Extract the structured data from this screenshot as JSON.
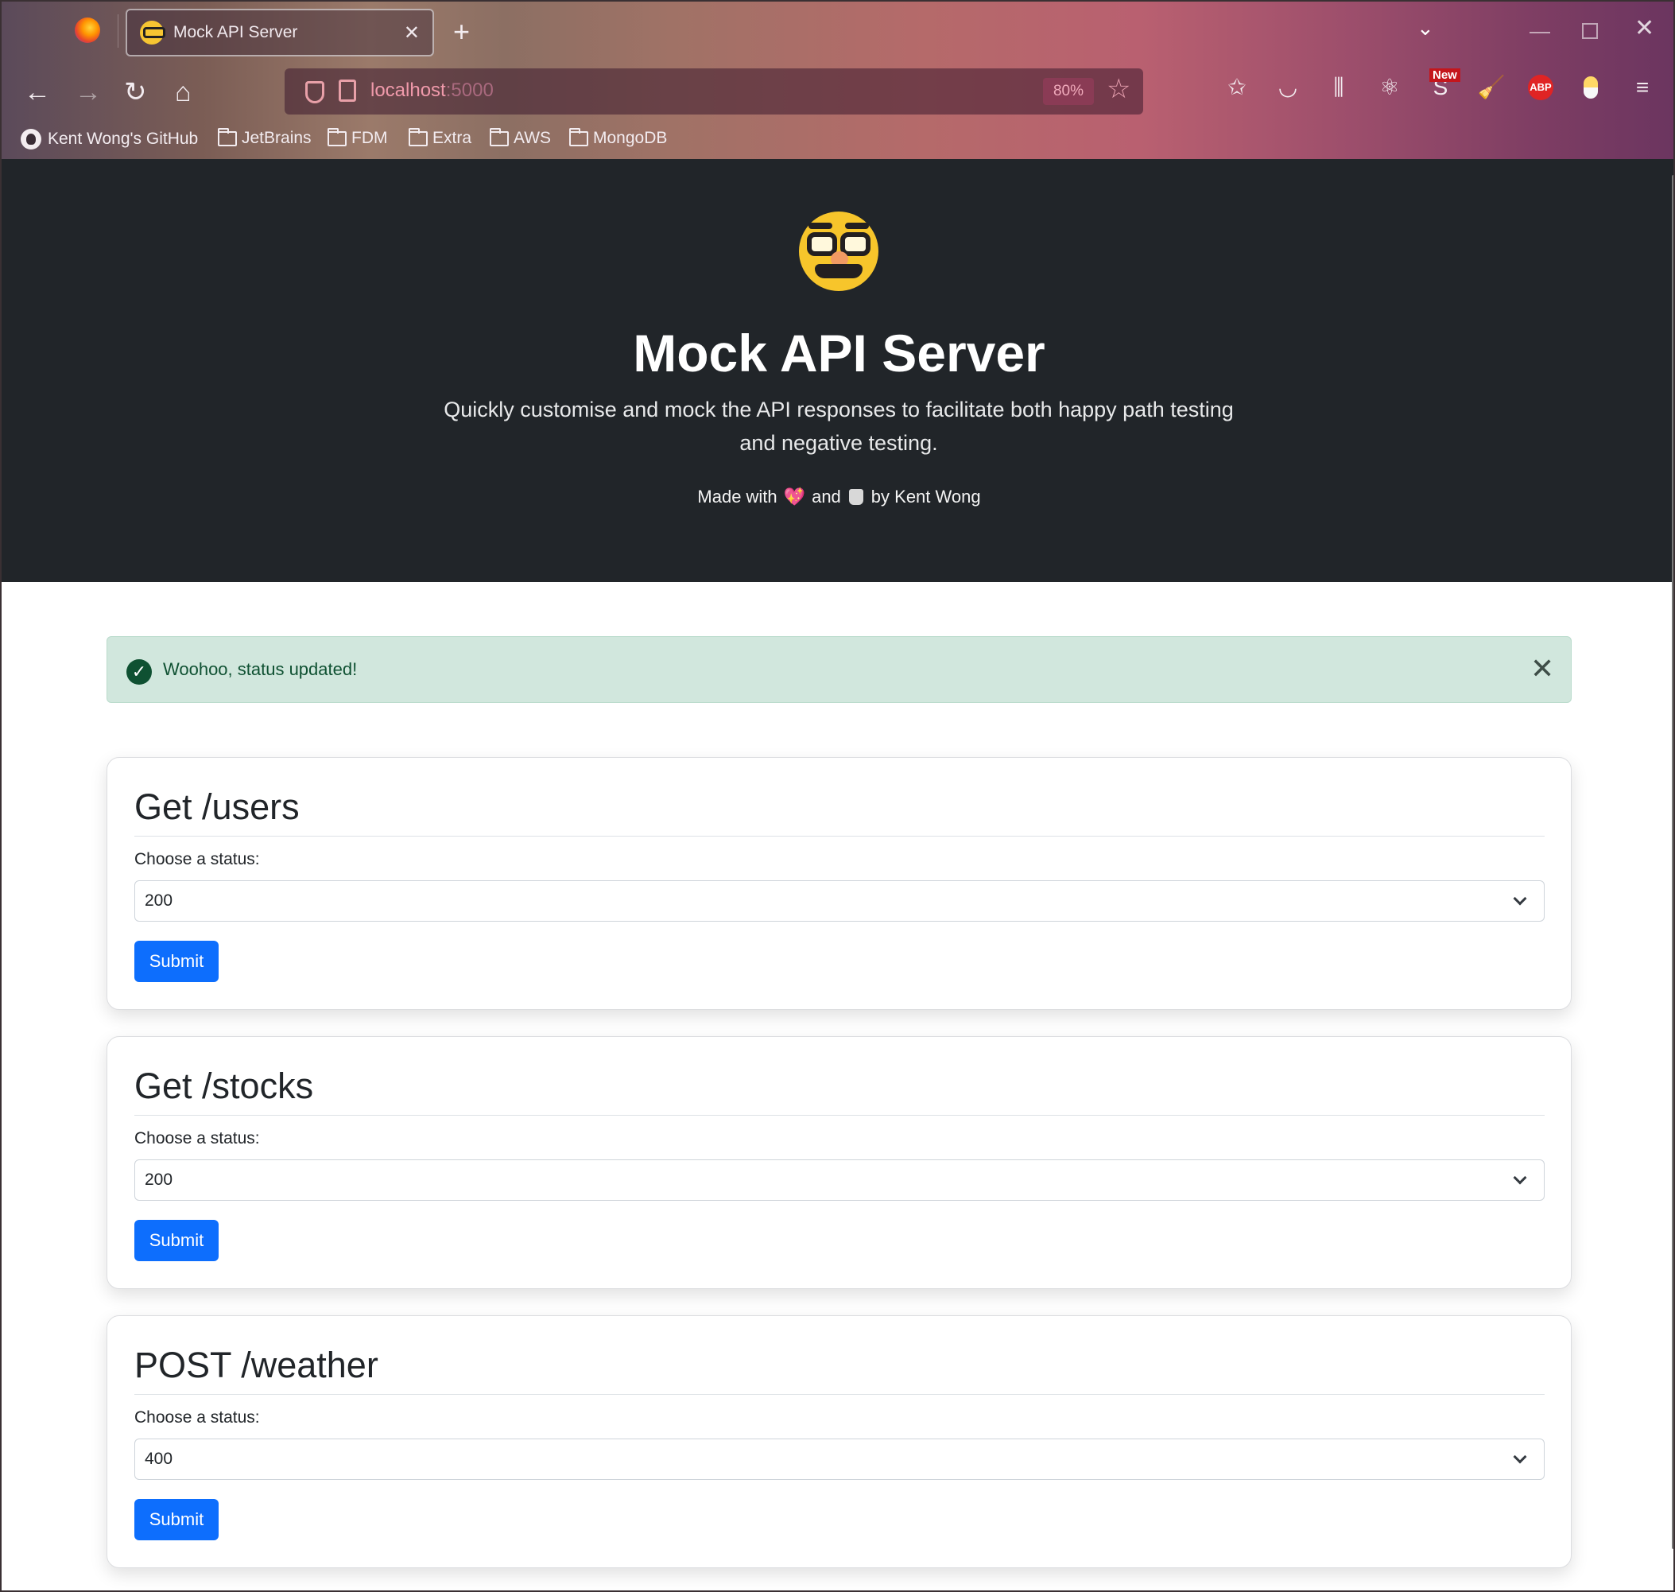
{
  "browser": {
    "tab_title": "Mock API Server",
    "url_host": "localhost",
    "url_port": ":5000",
    "zoom": "80%",
    "bookmarks": [
      "Kent Wong's GitHub",
      "JetBrains",
      "FDM",
      "Extra",
      "AWS",
      "MongoDB"
    ],
    "news_badge": "New",
    "abp_label": "ABP"
  },
  "hero": {
    "title": "Mock API Server",
    "lead": "Quickly customise and mock the API responses to facilitate both happy path testing and negative testing.",
    "credit_prefix": "Made with",
    "credit_and": "and",
    "credit_suffix": "by Kent Wong"
  },
  "alert": {
    "text": "Woohoo, status updated!"
  },
  "cards": [
    {
      "title": "Get /users",
      "label": "Choose a status:",
      "value": "200",
      "button": "Submit"
    },
    {
      "title": "Get /stocks",
      "label": "Choose a status:",
      "value": "200",
      "button": "Submit"
    },
    {
      "title": "POST /weather",
      "label": "Choose a status:",
      "value": "400",
      "button": "Submit"
    }
  ],
  "colors": {
    "hero_bg": "#212529",
    "alert_bg": "#d1e7dd",
    "primary": "#0d6efd"
  }
}
